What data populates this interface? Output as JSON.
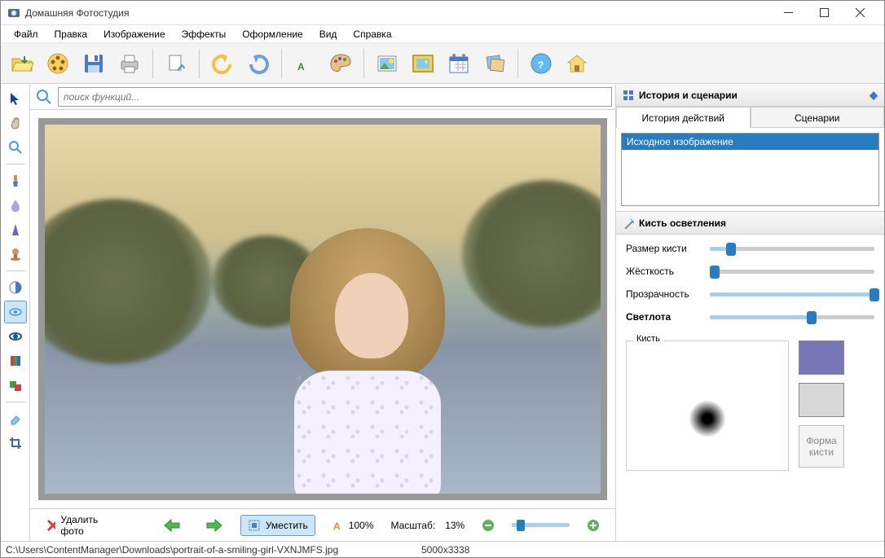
{
  "window": {
    "title": "Домашняя Фотостудия"
  },
  "menu": {
    "file": "Файл",
    "edit": "Правка",
    "image": "Изображение",
    "effects": "Эффекты",
    "decoration": "Оформление",
    "view": "Вид",
    "help": "Справка"
  },
  "search": {
    "placeholder": "поиск функций..."
  },
  "bottom": {
    "delete": "Удалить фото",
    "fit": "Уместить",
    "percent100": "100%",
    "scale_label": "Масштаб:",
    "scale_value": "13%"
  },
  "status": {
    "path": "C:\\Users\\ContentManager\\Downloads\\portrait-of-a-smiling-girl-VXNJMFS.jpg",
    "dim": "5000x3338"
  },
  "panels": {
    "history_title": "История и сценарии",
    "tab_history": "История действий",
    "tab_scenarios": "Сценарии",
    "history_item": "Исходное изображение",
    "brush_title": "Кисть осветления",
    "brush_size": "Размер кисти",
    "hardness": "Жёсткость",
    "opacity": "Прозрачность",
    "lightness": "Светлота",
    "brush_label": "Кисть",
    "shape_btn": "Форма\nкисти"
  },
  "sliders": {
    "size": 13,
    "hardness": 3,
    "opacity": 100,
    "lightness": 62
  },
  "colors": {
    "swatch1": "#7878b8",
    "swatch2": "#d8d8d8"
  }
}
